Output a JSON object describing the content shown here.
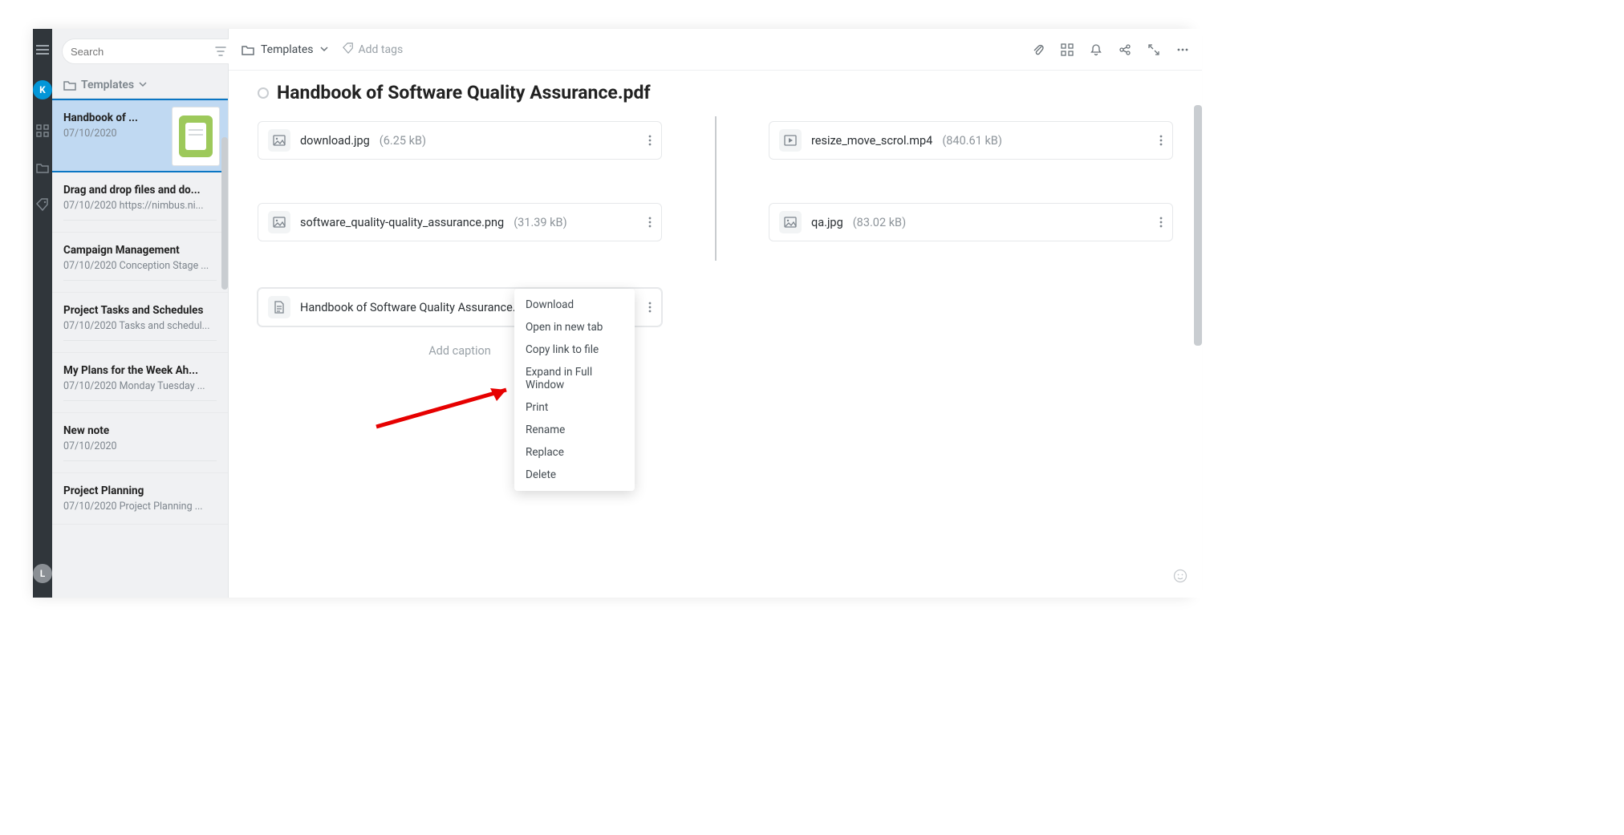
{
  "rail": {
    "avatar_top": "K",
    "avatar_bottom": "L"
  },
  "sidebar": {
    "search_placeholder": "Search",
    "breadcrumb_label": "Templates",
    "notes": [
      {
        "title": "Handbook of ...",
        "meta": "07/10/2020"
      },
      {
        "title": "Drag and drop files and do...",
        "meta": "07/10/2020 https://nimbus.ni..."
      },
      {
        "title": "Campaign Management",
        "meta": "07/10/2020 Conception Stage ..."
      },
      {
        "title": "Project Tasks and Schedules",
        "meta": "07/10/2020 Tasks and schedul..."
      },
      {
        "title": "My Plans for the Week Ah...",
        "meta": "07/10/2020 Monday Tuesday ..."
      },
      {
        "title": "New note",
        "meta": "07/10/2020"
      },
      {
        "title": "Project Planning",
        "meta": "07/10/2020 Project Planning ..."
      }
    ]
  },
  "toolbar": {
    "breadcrumb": "Templates",
    "add_tags": "Add tags"
  },
  "page": {
    "title": "Handbook of Software Quality Assurance.pdf",
    "caption": "Add caption",
    "files_left": [
      {
        "name": "download.jpg",
        "size": "(6.25 kB)",
        "type": "image"
      },
      {
        "name": "software_quality-quality_assurance.png",
        "size": "(31.39 kB)",
        "type": "image"
      },
      {
        "name": "Handbook of Software Quality Assurance.p",
        "size": "",
        "type": "doc"
      }
    ],
    "files_right": [
      {
        "name": "resize_move_scrol.mp4",
        "size": "(840.61 kB)",
        "type": "video"
      },
      {
        "name": "qa.jpg",
        "size": "(83.02 kB)",
        "type": "image"
      }
    ]
  },
  "menu": {
    "items": [
      "Download",
      "Open in new tab",
      "Copy link to file",
      "Expand in Full Window",
      "Print",
      "Rename",
      "Replace",
      "Delete"
    ]
  }
}
